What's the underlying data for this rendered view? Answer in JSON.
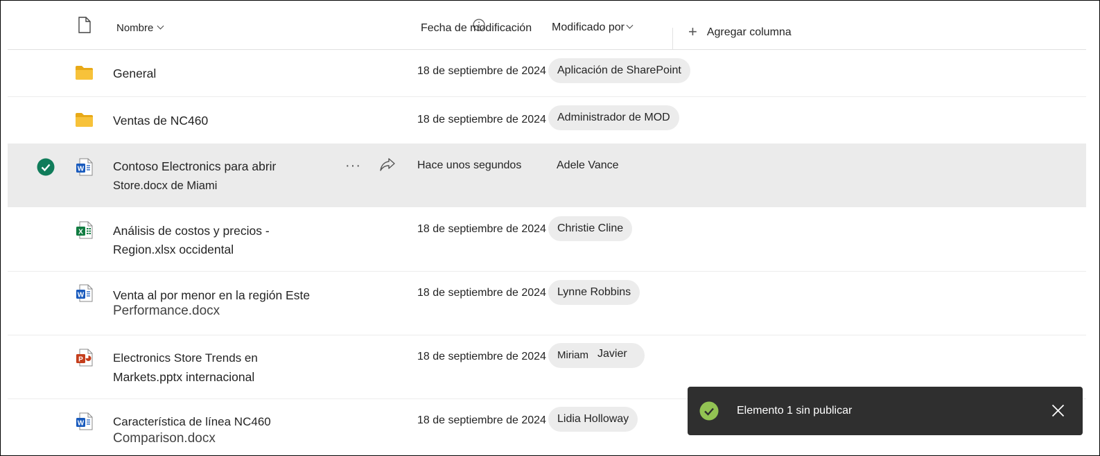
{
  "header": {
    "name_label": "Nombre",
    "modified_label": "Fecha de modificación",
    "modified_by_label": "Modificado por",
    "add_column_label": "Agregar columna"
  },
  "rows": [
    {
      "type": "folder",
      "name_l1": "General",
      "name_l2": "",
      "date": "18 de septiembre de 2024",
      "by": "Aplicación de SharePoint"
    },
    {
      "type": "folder",
      "name_l1": "Ventas de NC460",
      "name_l2": "",
      "date": "18 de septiembre de 2024",
      "by": "Administrador de MOD"
    },
    {
      "type": "word",
      "name_l1": "Contoso Electronics para abrir",
      "name_l2": "Store.docx de Miami",
      "date": "Hace unos segundos",
      "by": "Adele Vance",
      "selected": true
    },
    {
      "type": "excel",
      "name_l1": "Análisis de costos y precios -",
      "name_l2": "Region.xlsx occidental",
      "date": "18 de septiembre de 2024",
      "by": "Christie Cline"
    },
    {
      "type": "word",
      "name_l1": "Venta al por menor en la región Este",
      "name_l2": "Performance.docx",
      "date": "18 de septiembre de 2024",
      "by": "Lynne Robbins"
    },
    {
      "type": "ppt",
      "name_l1": "Electronics Store Trends en",
      "name_l2": "Markets.pptx internacional",
      "date": "18 de septiembre de 2024",
      "by_first": "Miriam",
      "by_last": "Javier"
    },
    {
      "type": "word",
      "name_l1": "Característica de línea NC460",
      "name_l2": "Comparison.docx",
      "date": "18 de septiembre de 2024",
      "by": "Lidia Holloway"
    }
  ],
  "toast": {
    "message": "Elemento 1 sin publicar"
  },
  "colors": {
    "folder": "#f7c23a",
    "word": "#185abd",
    "excel": "#107c41",
    "powerpoint": "#c43e1c",
    "check": "#107c5a",
    "toast_check": "#92c353",
    "toast_bg": "#2f2f2f"
  }
}
